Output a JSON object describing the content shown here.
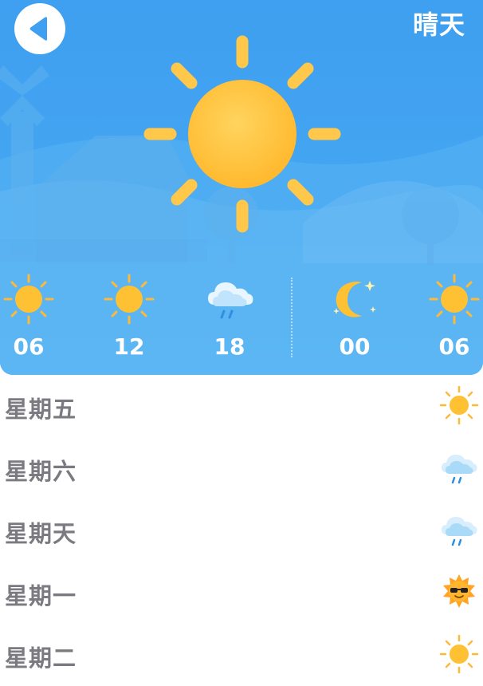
{
  "header": {
    "title": "晴天",
    "back_icon": "back-arrow-icon",
    "current_icon": "sun-icon",
    "colors": {
      "sky": "#3f9ff0",
      "sun": "#ffc53d",
      "text": "#ffffff"
    }
  },
  "hourly": [
    {
      "time": "06",
      "icon": "sun-icon"
    },
    {
      "time": "12",
      "icon": "sun-icon"
    },
    {
      "time": "18",
      "icon": "rain-cloud-icon"
    },
    {
      "time": "00",
      "icon": "moon-icon"
    },
    {
      "time": "06",
      "icon": "sun-icon"
    }
  ],
  "daily": [
    {
      "day": "星期五",
      "icon": "sun-icon"
    },
    {
      "day": "星期六",
      "icon": "rain-cloud-icon"
    },
    {
      "day": "星期天",
      "icon": "rain-cloud-icon"
    },
    {
      "day": "星期一",
      "icon": "sun-sunglasses-icon"
    },
    {
      "day": "星期二",
      "icon": "sun-icon"
    }
  ]
}
